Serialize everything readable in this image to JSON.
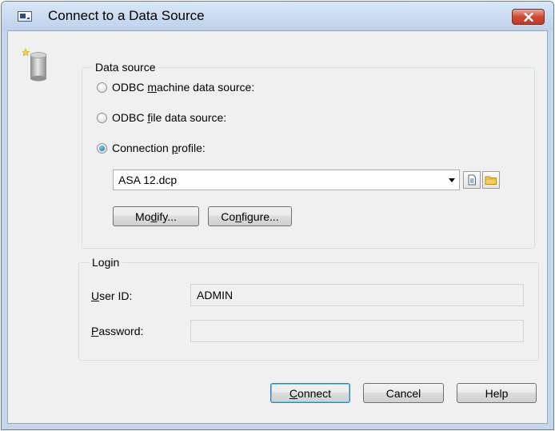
{
  "window": {
    "title": "Connect to a Data Source",
    "close_label": "×"
  },
  "data_source": {
    "group_label": "Data source",
    "options": [
      {
        "pre": "ODBC ",
        "key": "m",
        "post": "achine data source:",
        "checked": false
      },
      {
        "pre": "ODBC ",
        "key": "f",
        "post": "ile data source:",
        "checked": false
      },
      {
        "pre": "Connection ",
        "key": "p",
        "post": "rofile:",
        "checked": true
      }
    ],
    "profile_value": "ASA 12.dcp",
    "modify_button": {
      "pre": "Mo",
      "key": "d",
      "post": "ify..."
    },
    "configure_button": {
      "pre": "Co",
      "key": "n",
      "post": "figure..."
    }
  },
  "login": {
    "group_label": "Login",
    "user_id_label": {
      "key": "U",
      "post": "ser ID:"
    },
    "user_id_value": "ADMIN",
    "password_label": {
      "key": "P",
      "post": "assword:"
    },
    "password_value": ""
  },
  "buttons": {
    "connect": {
      "key": "C",
      "post": "onnect"
    },
    "cancel": "Cancel",
    "help": "Help"
  },
  "colors": {
    "title_bar": "#c3d6ec",
    "close_button": "#c9432e",
    "dialog_background": "#f0f0f0"
  },
  "icons": {
    "title": "window-icon",
    "database": "database-icon",
    "combo_arrow": "chevron-down-icon",
    "new_file": "new-document-icon",
    "open_folder": "folder-icon"
  }
}
